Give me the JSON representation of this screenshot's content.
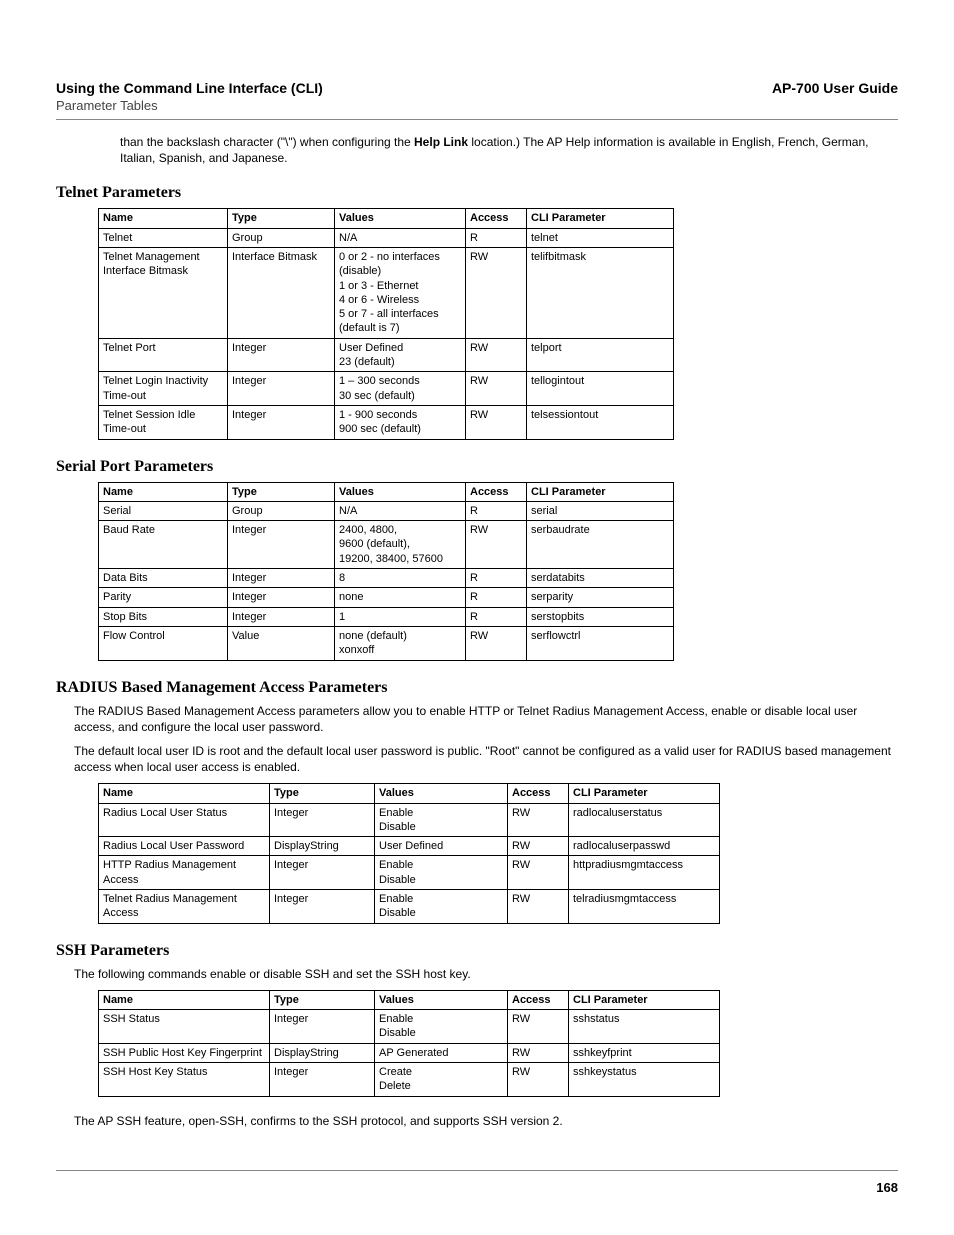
{
  "header": {
    "left": "Using the Command Line Interface (CLI)",
    "right": "AP-700 User Guide",
    "sub": "Parameter Tables"
  },
  "top_paragraph": {
    "pre": "than the backslash character (\"\\\") when configuring the ",
    "bold1": "Help Link",
    "post": " location.) The AP Help information is available in English, French, German, Italian, Spanish, and Japanese."
  },
  "columns": {
    "name": "Name",
    "type": "Type",
    "values": "Values",
    "access": "Access",
    "cli": "CLI Parameter"
  },
  "telnet": {
    "title": "Telnet Parameters",
    "rows": [
      {
        "name": "Telnet",
        "type": "Group",
        "values": "N/A",
        "access": "R",
        "cli": "telnet"
      },
      {
        "name": "Telnet Management Interface Bitmask",
        "type": "Interface Bitmask",
        "values": "0 or 2 - no interfaces (disable)\n1 or 3 - Ethernet\n4 or 6 - Wireless\n5 or 7 - all interfaces (default is 7)",
        "access": "RW",
        "cli": "telifbitmask"
      },
      {
        "name": "Telnet Port",
        "type": "Integer",
        "values": "User Defined\n23 (default)",
        "access": "RW",
        "cli": "telport"
      },
      {
        "name": "Telnet Login Inactivity Time-out",
        "type": "Integer",
        "values": "1 – 300 seconds\n30 sec (default)",
        "access": "RW",
        "cli": "tellogintout"
      },
      {
        "name": "Telnet Session Idle Time-out",
        "type": "Integer",
        "values": "1 - 900 seconds\n900 sec (default)",
        "access": "RW",
        "cli": "telsessiontout"
      }
    ]
  },
  "serial": {
    "title": "Serial Port Parameters",
    "rows": [
      {
        "name": "Serial",
        "type": "Group",
        "values": "N/A",
        "access": "R",
        "cli": "serial"
      },
      {
        "name": "Baud Rate",
        "type": "Integer",
        "values": "2400, 4800,\n9600 (default),\n19200, 38400, 57600",
        "access": "RW",
        "cli": "serbaudrate"
      },
      {
        "name": "Data Bits",
        "type": "Integer",
        "values": "8",
        "access": "R",
        "cli": "serdatabits"
      },
      {
        "name": "Parity",
        "type": "Integer",
        "values": "none",
        "access": "R",
        "cli": "serparity"
      },
      {
        "name": "Stop Bits",
        "type": "Integer",
        "values": "1",
        "access": "R",
        "cli": "serstopbits"
      },
      {
        "name": "Flow Control",
        "type": "Value",
        "values": "none (default)\nxonxoff",
        "access": "RW",
        "cli": "serflowctrl"
      }
    ]
  },
  "radius": {
    "title": "RADIUS Based Management Access Parameters",
    "intro1": "The RADIUS Based Management Access parameters allow you to enable HTTP or Telnet Radius Management Access, enable or disable local user access, and configure the local user password.",
    "intro2": "The default local user ID is root and the default local user password is public. \"Root\" cannot be configured as a valid user for RADIUS based management access when local user access is enabled.",
    "rows": [
      {
        "name": "Radius Local User Status",
        "type": "Integer",
        "values": "Enable\nDisable",
        "access": "RW",
        "cli": "radlocaluserstatus"
      },
      {
        "name": "Radius Local User Password",
        "type": "DisplayString",
        "values": "User Defined",
        "access": "RW",
        "cli": "radlocaluserpasswd"
      },
      {
        "name": "HTTP Radius Management Access",
        "type": "Integer",
        "values": "Enable\nDisable",
        "access": "RW",
        "cli": "httpradiusmgmtaccess"
      },
      {
        "name": "Telnet Radius Management Access",
        "type": "Integer",
        "values": "Enable\nDisable",
        "access": "RW",
        "cli": "telradiusmgmtaccess"
      }
    ]
  },
  "ssh": {
    "title": "SSH Parameters",
    "intro": "The following commands enable or disable SSH and set the SSH host key.",
    "rows": [
      {
        "name": "SSH Status",
        "type": "Integer",
        "values": "Enable\nDisable",
        "access": "RW",
        "cli": "sshstatus"
      },
      {
        "name": "SSH Public Host Key Fingerprint",
        "type": "DisplayString",
        "values": "AP Generated",
        "access": "RW",
        "cli": "sshkeyfprint"
      },
      {
        "name": "SSH Host Key Status",
        "type": "Integer",
        "values": "Create\nDelete",
        "access": "RW",
        "cli": "sshkeystatus"
      }
    ],
    "outro": "The AP SSH feature, open-SSH, confirms to the SSH protocol, and supports SSH version 2."
  },
  "page_number": "168"
}
